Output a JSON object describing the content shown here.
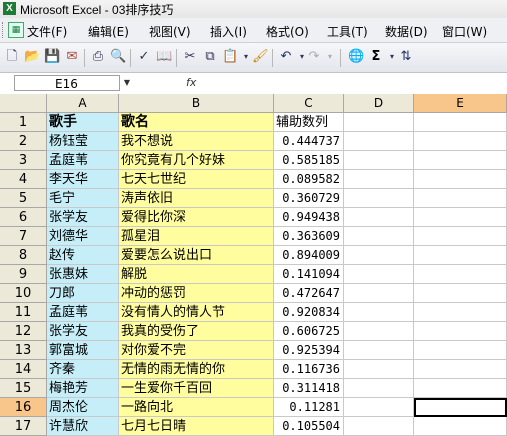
{
  "window": {
    "title": "Microsoft Excel - 03排序技巧",
    "app_icon_letter": "X"
  },
  "menu": [
    "文件(F)",
    "编辑(E)",
    "视图(V)",
    "插入(I)",
    "格式(O)",
    "工具(T)",
    "数据(D)",
    "窗口(W)"
  ],
  "toolbar": {
    "icons": [
      "new-icon",
      "open-icon",
      "save-icon",
      "permission-icon",
      "print-icon",
      "print-preview-icon",
      "spelling-icon",
      "research-icon",
      "cut-icon",
      "copy-icon",
      "paste-icon",
      "format-painter-icon",
      "undo-icon",
      "redo-icon",
      "hyperlink-icon",
      "autosum-icon",
      "sort-ascending-icon"
    ],
    "sum_label": "Σ"
  },
  "formula_bar": {
    "name_box": "E16",
    "fx_label": "fx",
    "value": ""
  },
  "columns": [
    "A",
    "B",
    "C",
    "D",
    "E"
  ],
  "selected_column": "E",
  "selected_row": 16,
  "rows": [
    {
      "num": "1",
      "a": "歌手",
      "b": "歌名",
      "c": "辅助数列"
    },
    {
      "num": "2",
      "a": "杨钰莹",
      "b": "我不想说",
      "c": "0.444737"
    },
    {
      "num": "3",
      "a": "孟庭苇",
      "b": "你究竟有几个好妹",
      "c": "0.585185"
    },
    {
      "num": "4",
      "a": "李天华",
      "b": "七天七世纪",
      "c": "0.089582"
    },
    {
      "num": "5",
      "a": "毛宁",
      "b": "涛声依旧",
      "c": "0.360729"
    },
    {
      "num": "6",
      "a": "张学友",
      "b": "爱得比你深",
      "c": "0.949438"
    },
    {
      "num": "7",
      "a": "刘德华",
      "b": "孤星泪",
      "c": "0.363609"
    },
    {
      "num": "8",
      "a": "赵传",
      "b": "爱要怎么说出口",
      "c": "0.894009"
    },
    {
      "num": "9",
      "a": "张惠妹",
      "b": "解脱",
      "c": "0.141094"
    },
    {
      "num": "10",
      "a": "刀郎",
      "b": "冲动的惩罚",
      "c": "0.472647"
    },
    {
      "num": "11",
      "a": "孟庭苇",
      "b": "没有情人的情人节",
      "c": "0.920834"
    },
    {
      "num": "12",
      "a": "张学友",
      "b": "我真的受伤了",
      "c": "0.606725"
    },
    {
      "num": "13",
      "a": "郭富城",
      "b": "对你爱不完",
      "c": "0.925394"
    },
    {
      "num": "14",
      "a": "齐秦",
      "b": "无情的雨无情的你",
      "c": "0.116736"
    },
    {
      "num": "15",
      "a": "梅艳芳",
      "b": "一生爱你千百回",
      "c": "0.311418"
    },
    {
      "num": "16",
      "a": "周杰伦",
      "b": "一路向北",
      "c": "0.11281"
    },
    {
      "num": "17",
      "a": "许慧欣",
      "b": "七月七日晴",
      "c": "0.105504"
    }
  ],
  "colors": {
    "col_a": "#c6eef8",
    "col_b": "#fffd9e",
    "selected_header": "#f8c68a"
  }
}
